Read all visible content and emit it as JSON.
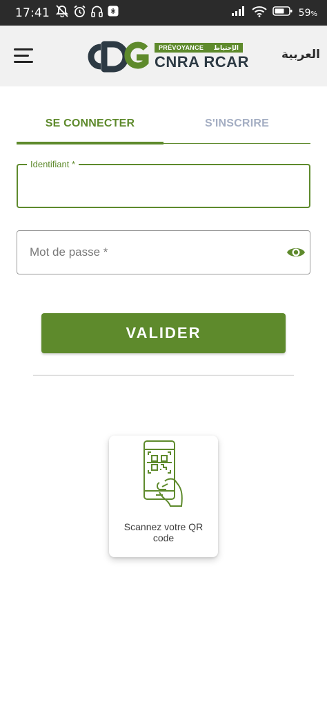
{
  "status_bar": {
    "time": "17:41",
    "battery_percent": "59",
    "battery_unit": "%",
    "icons": [
      "muted-notifications-icon",
      "alarm-icon",
      "headset-icon",
      "app-notification-icon",
      "signal-icon",
      "wifi-icon",
      "battery-icon"
    ]
  },
  "header": {
    "menu_icon": "hamburger-menu-icon",
    "logo": {
      "mark": "CDG",
      "badge_left": "PRÉVOYANCE",
      "badge_right": "الإحتياط",
      "subtitle": "CNRA RCAR"
    },
    "language_link": "العربية"
  },
  "tabs": [
    {
      "label": "SE CONNECTER",
      "active": true
    },
    {
      "label": "S'INSCRIRE",
      "active": false
    }
  ],
  "form": {
    "identifier": {
      "label": "Identifiant *",
      "value": ""
    },
    "password": {
      "placeholder": "Mot de passe *",
      "value": "",
      "toggle_icon": "eye-icon"
    },
    "submit_label": "VALIDER"
  },
  "qr_card": {
    "icon": "phone-qr-scan-icon",
    "label": "Scannez votre QR code"
  },
  "colors": {
    "accent": "#5e8a2c",
    "status_bar": "#2b2b2b",
    "header_bg": "#f1f1f1",
    "inactive_tab": "#a4aec3"
  }
}
